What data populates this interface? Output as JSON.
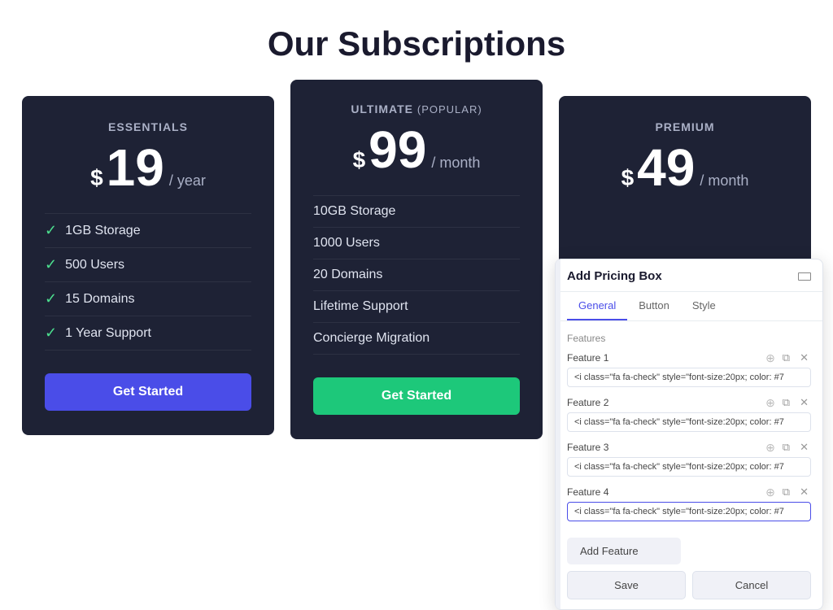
{
  "page": {
    "title": "Our Subscriptions"
  },
  "cards": [
    {
      "id": "essentials",
      "title": "ESSENTIALS",
      "popular": false,
      "price_dollar": "$",
      "price_amount": "19",
      "price_period": "/ year",
      "features": [
        "1GB Storage",
        "500 Users",
        "15 Domains",
        "1 Year Support"
      ],
      "cta_label": "Get Started",
      "cta_style": "blue"
    },
    {
      "id": "ultimate",
      "title": "ULTIMATE",
      "popular_badge": "(Popular)",
      "popular": true,
      "price_dollar": "$",
      "price_amount": "99",
      "price_period": "/ month",
      "features": [
        "10GB Storage",
        "1000 Users",
        "20 Domains",
        "Lifetime Support",
        "Concierge Migration"
      ],
      "cta_label": "Get Started",
      "cta_style": "green"
    },
    {
      "id": "premium",
      "title": "PREMIUM",
      "popular": false,
      "price_dollar": "$",
      "price_amount": "49",
      "price_period": "/ month",
      "features": [],
      "cta_label": "",
      "cta_style": "blue"
    }
  ],
  "panel": {
    "title": "Add Pricing Box",
    "tabs": [
      "General",
      "Button",
      "Style"
    ],
    "active_tab": "General",
    "section_label": "Features",
    "features": [
      {
        "label": "Feature 1",
        "value": "<i class=\"fa fa-check\" style=\"font-size:20px; color: #7"
      },
      {
        "label": "Feature 2",
        "value": "<i class=\"fa fa-check\" style=\"font-size:20px; color: #7"
      },
      {
        "label": "Feature 3",
        "value": "<i class=\"fa fa-check\" style=\"font-size:20px; color: #7"
      },
      {
        "label": "Feature 4",
        "value": "<i class=\"fa fa-check\" style=\"font-size:20px; color: #7"
      }
    ],
    "add_feature_label": "Add Feature",
    "save_label": "Save",
    "cancel_label": "Cancel"
  }
}
